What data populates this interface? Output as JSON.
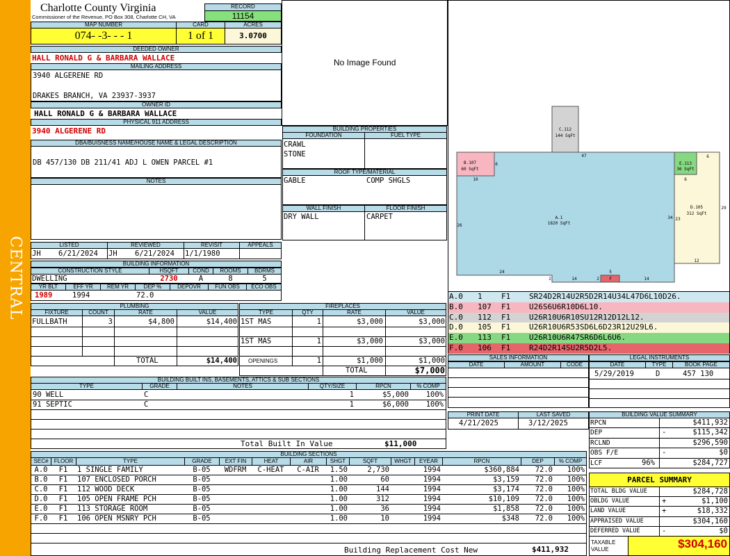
{
  "side_label": "CENTRAL",
  "county": {
    "name": "Charlotte County Virginia",
    "address": "Commissioner of the Revenue, PO Box 308, Charlotte CH, VA"
  },
  "record": {
    "label": "RECORD",
    "value": "11154"
  },
  "map": {
    "label": "MAP NUMBER",
    "value": "074- -3- - - 1"
  },
  "card": {
    "label": "CARD",
    "value": "1 of 1"
  },
  "acres": {
    "label": "ACRES",
    "value": "3.0700"
  },
  "deeded_owner": {
    "label": "DEEDED OWNER",
    "value": "HALL RONALD G & BARBARA WALLACE"
  },
  "mailing": {
    "label": "MAILING ADDRESS",
    "line1": "3940 ALGERENE RD",
    "line2": "DRAKES BRANCH, VA 23937-3937"
  },
  "owner_id": {
    "label": "OWNER ID",
    "value": "HALL RONALD G & BARBARA WALLACE"
  },
  "physical": {
    "label": "PHYSICAL 911 ADDRESS",
    "value": "3940 ALGERENE RD"
  },
  "dba": {
    "label": "DBA/BUISNESS NAME/HOUSE NAME & LEGAL DESCRIPTION",
    "value": "DB 457/130 DB 211/41 ADJ L OWEN PARCEL #1"
  },
  "notes": {
    "label": "NOTES"
  },
  "photo": {
    "text": "No Image Found"
  },
  "building_props": {
    "label": "BUILDING PROPERTIES",
    "foundation_label": "FOUNDATION",
    "foundation_1": "CRAWL",
    "foundation_2": "STONE",
    "fuel_label": "FUEL TYPE",
    "roof_label": "ROOF TYPE/MATERIAL",
    "roof_type": "GABLE",
    "roof_material": "COMP SHGLS",
    "wall_label": "WALL FINISH",
    "wall": "DRY WALL",
    "floor_label": "FLOOR FINISH",
    "floor": "CARPET"
  },
  "listed": {
    "label": "LISTED",
    "by": "JH",
    "date": "6/21/2024"
  },
  "reviewed": {
    "label": "REVIEWED",
    "by": "JH",
    "date": "6/21/2024"
  },
  "revisit": {
    "label": "REVISIT",
    "date": "1/1/1980"
  },
  "appeals": {
    "label": "APPEALS"
  },
  "building_info": {
    "label": "BUILDING INFORMATION",
    "style_label": "CONSTRUCTION STYLE",
    "style": "DWELLING",
    "hsqft_label": "HSQFT",
    "hsqft": "2730",
    "cond_label": "COND",
    "cond": "A",
    "rooms_label": "ROOMS",
    "rooms": "8",
    "bdrms_label": "BDRMS",
    "bdrms": "5",
    "yrblt_label": "YR BLT",
    "yrblt": "1989",
    "effyr_label": "EFF YR",
    "effyr": "1994",
    "remyr_label": "REM YR",
    "dep_label": "DEP %",
    "dep": "72.0",
    "depovr_label": "DEPOVR",
    "funobs_label": "FUN OBS",
    "ecoobs_label": "ECO OBS"
  },
  "plumbing": {
    "label": "PLUMBING",
    "headers": [
      "FIXTURE",
      "COUNT",
      "RATE",
      "VALUE"
    ],
    "rows": [
      [
        "FULLBATH",
        "3",
        "$4,800",
        "$14,400"
      ]
    ],
    "total_label": "TOTAL",
    "total": "$14,400"
  },
  "fireplaces": {
    "label": "FIREPLACES",
    "headers": [
      "TYPE",
      "QTY",
      "RATE",
      "VALUE"
    ],
    "rows": [
      [
        "1ST MAS",
        "1",
        "$3,000",
        "$3,000"
      ],
      [
        "1ST MAS",
        "1",
        "$3,000",
        "$3,000"
      ]
    ],
    "openings": [
      "OPENINGS",
      "1",
      "$1,000",
      "$1,000"
    ],
    "total_label": "TOTAL",
    "total": "$7,000"
  },
  "sketch_labels": {
    "c112": "C.112",
    "c112s": "144 SqFt",
    "b107": "B.107",
    "b107s": "60 SqFt",
    "e113": "E.113",
    "e113s": "36 SqFt",
    "d105": "D.105",
    "d105s": "312 SqFt",
    "a1": "A.1",
    "a1s": "1820 SqFt",
    "f": "F",
    "n47": "47",
    "n6a": "6",
    "n10": "10",
    "n6b": "6",
    "n6c": "6",
    "n29": "29",
    "n26": "26",
    "n34": "34",
    "n23": "23",
    "n12": "12",
    "n24": "24",
    "n5": "5",
    "n2a": "2",
    "n14a": "14",
    "n2b": "2",
    "n14b": "14"
  },
  "sketch_codes": [
    {
      "sec": "A.0",
      "num": "1",
      "fl": "F1",
      "code": "SR24D2R14U2R5D2R14U34L47D6L10D26.",
      "color": "#cfe8ef"
    },
    {
      "sec": "B.0",
      "num": "107",
      "fl": "F1",
      "code": "U26S6U6R10D6L10.",
      "color": "#f7b6c0"
    },
    {
      "sec": "C.0",
      "num": "112",
      "fl": "F1",
      "code": "U26R10U6R10SU12R12D12L12.",
      "color": "#d3d3d3"
    },
    {
      "sec": "D.0",
      "num": "105",
      "fl": "F1",
      "code": "U26R10U6R53SD6L6D23R12U29L6.",
      "color": "#fbf7d8"
    },
    {
      "sec": "E.0",
      "num": "113",
      "fl": "F1",
      "code": "U26R10U6R47SR6D6L6U6.",
      "color": "#86d982"
    },
    {
      "sec": "F.0",
      "num": "106",
      "fl": "F1",
      "code": "R24D2R14SU2R5D2L5.",
      "color": "#e5656b"
    }
  ],
  "sales": {
    "label": "SALES INFORMATION",
    "headers": [
      "DATE",
      "AMOUNT",
      "CODE"
    ]
  },
  "legal": {
    "label": "LEGAL INSTRUMENTS",
    "headers": [
      "DATE",
      "TYPE",
      "BOOK PAGE"
    ],
    "rows": [
      [
        "5/29/2019",
        "D",
        "457 130"
      ]
    ]
  },
  "built_ins": {
    "label": "BUILDING BUILT INS, BASEMENTS, ATTICS & SUB SECTIONS",
    "headers": [
      "TYPE",
      "GRADE",
      "NOTES",
      "QTY/SIZE",
      "RPCN",
      "% COMP"
    ],
    "rows": [
      [
        "90 WELL",
        "C",
        "",
        "1",
        "$5,000",
        "100%"
      ],
      [
        "91 SEPTIC",
        "C",
        "",
        "1",
        "$6,000",
        "100%"
      ]
    ],
    "total_label": "Total Built In Value",
    "total": "$11,000"
  },
  "print": {
    "label": "PRINT DATE",
    "value": "4/21/2025"
  },
  "saved": {
    "label": "LAST SAVED",
    "value": "3/12/2025"
  },
  "bvs": {
    "label": "BUILDING VALUE SUMMARY",
    "rows": [
      [
        "RPCN",
        "",
        "",
        "$411,932"
      ],
      [
        "DEP",
        "",
        "-",
        "$115,342"
      ],
      [
        "RCLND",
        "",
        "",
        "$296,590"
      ],
      [
        "OBS F/E",
        "",
        "-",
        "$0"
      ],
      [
        "LCF",
        "96%",
        "",
        "$284,727"
      ]
    ]
  },
  "parcel": {
    "title": "PARCEL SUMMARY",
    "rows": [
      [
        "TOTAL BLDG VALUE",
        "",
        "$284,728"
      ],
      [
        "OBLDG VALUE",
        "+",
        "$1,100"
      ],
      [
        "LAND VALUE",
        "+",
        "$18,332"
      ],
      [
        "APPRAISED VALUE",
        "",
        "$304,160"
      ],
      [
        "DEFERRED VALUE",
        "-",
        "$0"
      ]
    ],
    "taxable_label": "TAXABLE VALUE",
    "taxable": "$304,160"
  },
  "sections": {
    "label": "BUILDING SECTIONS",
    "headers": [
      "SEC#",
      "FLOOR",
      "TYPE",
      "GRADE",
      "EXT FIN",
      "HEAT",
      "AIR",
      "SHGT",
      "SQFT",
      "WHGT",
      "EYEAR",
      "RPCN",
      "DEP",
      "% COMP"
    ],
    "rows": [
      [
        "A.0",
        "F1",
        "1 SINGLE FAMILY",
        "B-05",
        "WDFRM",
        "C-HEAT",
        "C-AIR",
        "1.50",
        "2,730",
        "",
        "1994",
        "$360,884",
        "72.0",
        "100%"
      ],
      [
        "B.0",
        "F1",
        "107 ENCLOSED PORCH",
        "B-05",
        "",
        "",
        "",
        "1.00",
        "60",
        "",
        "1994",
        "$3,159",
        "72.0",
        "100%"
      ],
      [
        "C.0",
        "F1",
        "112 WOOD DECK",
        "B-05",
        "",
        "",
        "",
        "1.00",
        "144",
        "",
        "1994",
        "$3,174",
        "72.0",
        "100%"
      ],
      [
        "D.0",
        "F1",
        "105 OPEN FRAME PCH",
        "B-05",
        "",
        "",
        "",
        "1.00",
        "312",
        "",
        "1994",
        "$10,109",
        "72.0",
        "100%"
      ],
      [
        "E.0",
        "F1",
        "113 STORAGE ROOM",
        "B-05",
        "",
        "",
        "",
        "1.00",
        "36",
        "",
        "1994",
        "$1,858",
        "72.0",
        "100%"
      ],
      [
        "F.0",
        "F1",
        "106 OPEN MSNRY PCH",
        "B-05",
        "",
        "",
        "",
        "1.00",
        "10",
        "",
        "1994",
        "$348",
        "72.0",
        "100%"
      ]
    ],
    "brc_label": "Building Replacement Cost New",
    "brc": "$411,932"
  },
  "colors": {
    "side": "#f7a400",
    "header": "#b8dbe8",
    "record_fill": "#86e07b",
    "yellow": "#ffff33",
    "sketch_main": "#add8e6"
  }
}
